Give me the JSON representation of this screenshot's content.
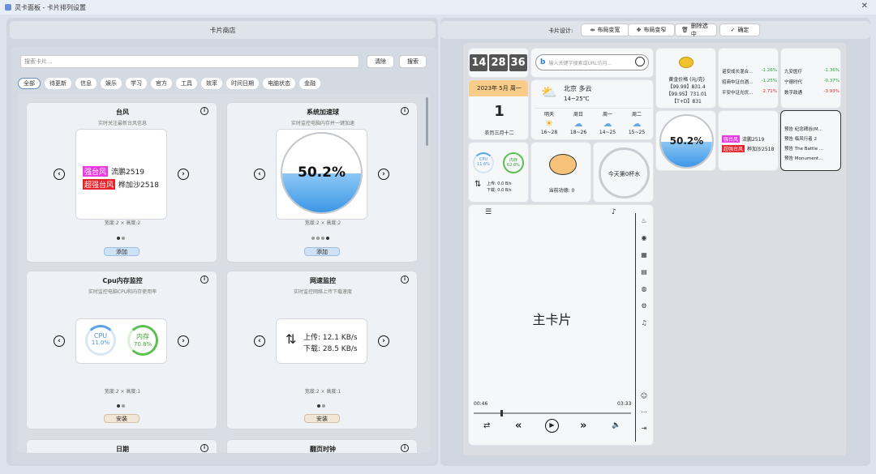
{
  "window": {
    "title": "灵卡面板 - 卡片排列设置",
    "close": "✕"
  },
  "shop": {
    "title": "卡片商店",
    "search_placeholder": "搜索卡片...",
    "clear_label": "清除",
    "search_label": "搜索",
    "categories": [
      "全部",
      "待更新",
      "信息",
      "娱乐",
      "学习",
      "官方",
      "工具",
      "效率",
      "时间日期",
      "电脑状态",
      "金融"
    ],
    "cards": [
      {
        "title": "台风",
        "subtitle": "实时关注最新台风信息",
        "line1_tag": "强台风",
        "line1_name": "流鹏2519",
        "line2_tag": "超强台风",
        "line2_name": "桦加沙2518",
        "size": "宽度:2 × 高度:2",
        "action": "添加"
      },
      {
        "title": "系统加速球",
        "subtitle": "实时监控电脑内存并一键加速",
        "value": "50.2%",
        "size": "宽度:2 × 高度:2",
        "action": "添加"
      },
      {
        "title": "Cpu内存监控",
        "subtitle": "实时监控电脑CPU和内存使用率",
        "cpu_label": "CPU",
        "cpu_value": "11.0%",
        "mem_label": "内存",
        "mem_value": "70.8%",
        "size": "宽度:2 × 高度:1",
        "action": "安装"
      },
      {
        "title": "网速监控",
        "subtitle": "实时监控网络上传下载速度",
        "up": "上传: 12.1 KB/s",
        "down": "下载: 28.5 KB/s",
        "size": "宽度:2 × 高度:1",
        "action": "安装"
      },
      {
        "title": "日期"
      },
      {
        "title": "翻页时钟"
      }
    ]
  },
  "design": {
    "label": "卡片设计:",
    "buttons": [
      "布局变宽",
      "布局变窄",
      "删除选中",
      "确定"
    ]
  },
  "preview": {
    "clock": {
      "h": "14",
      "m": "28",
      "s": "36"
    },
    "search_placeholder": "输入关键字搜索或URL访问...",
    "gold": {
      "line1": "黄金价格 (元/克)",
      "line2": "【99.99】831.4",
      "line3": "【99.95】731.01",
      "line4": "【T+D】831"
    },
    "funds1": [
      {
        "name": "诺安成长混合...",
        "val": "-1.26%",
        "c": "green"
      },
      {
        "name": "招商中证白酒...",
        "val": "-1.25%",
        "c": "green"
      },
      {
        "name": "平安中证光伏...",
        "val": "2.71%",
        "c": "red"
      }
    ],
    "funds2": [
      {
        "name": "九安医疗",
        "val": "-1.36%",
        "c": "green"
      },
      {
        "name": "宁德时代",
        "val": "-0.37%",
        "c": "green"
      },
      {
        "name": "数字政通",
        "val": "-3.93%",
        "c": "red"
      }
    ],
    "date": {
      "header": "2023年 5月 周一",
      "day": "1",
      "lunar": "农历三月十二"
    },
    "weather": {
      "city": "北京 多云",
      "range": "14~25℃",
      "days": [
        {
          "n": "明天",
          "r": "16~28"
        },
        {
          "n": "周日",
          "r": "18~26"
        },
        {
          "n": "周一",
          "r": "14~25"
        },
        {
          "n": "周二",
          "r": "15~25"
        }
      ]
    },
    "ball": "50.2%",
    "typhoon": {
      "tag1": "强台风",
      "name1": "流鹏2519",
      "tag2": "超强台风",
      "name2": "桦加沙2518"
    },
    "games": [
      "预告 纪念碑谷(M...",
      "预告 临风行者 2",
      "预告 The Battle ...",
      "预告 Monument..."
    ],
    "cpu": {
      "l1": "CPU",
      "v1": "11.6%",
      "l2": "内存",
      "v2": "62.8%",
      "up": "上传: 0.0 B/s",
      "down": "下载: 0.0 B/s"
    },
    "fish": "当前功德: 0",
    "water": "今天第0杯水",
    "main": "主卡片",
    "player": {
      "cur": "00:46",
      "total": "03:33",
      "progress": 0.17
    }
  }
}
